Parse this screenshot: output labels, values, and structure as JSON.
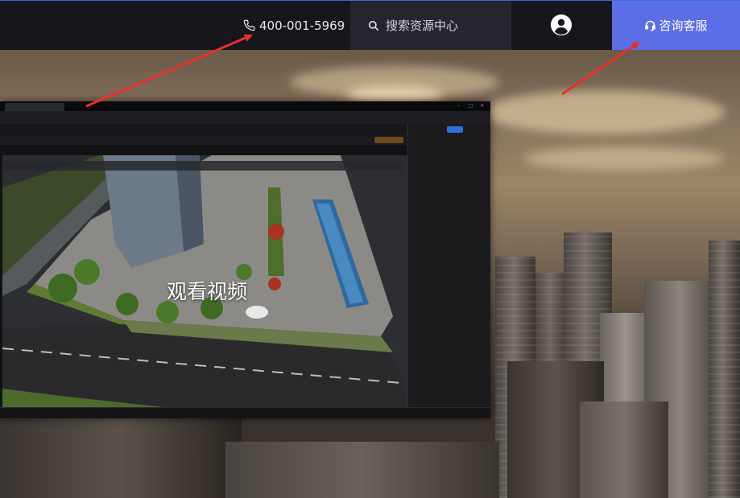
{
  "header": {
    "phone": "400-001-5969",
    "search_placeholder": "搜索资源中心",
    "consult_label": "咨询客服"
  },
  "video": {
    "play_label": "观看视频"
  },
  "colors": {
    "accent": "#5b6ee6",
    "header_bg": "#16161c",
    "search_bg": "#25252d",
    "arrow": "#e8302a"
  },
  "icons": [
    "phone-icon",
    "search-icon",
    "user-avatar-icon",
    "headset-icon"
  ]
}
